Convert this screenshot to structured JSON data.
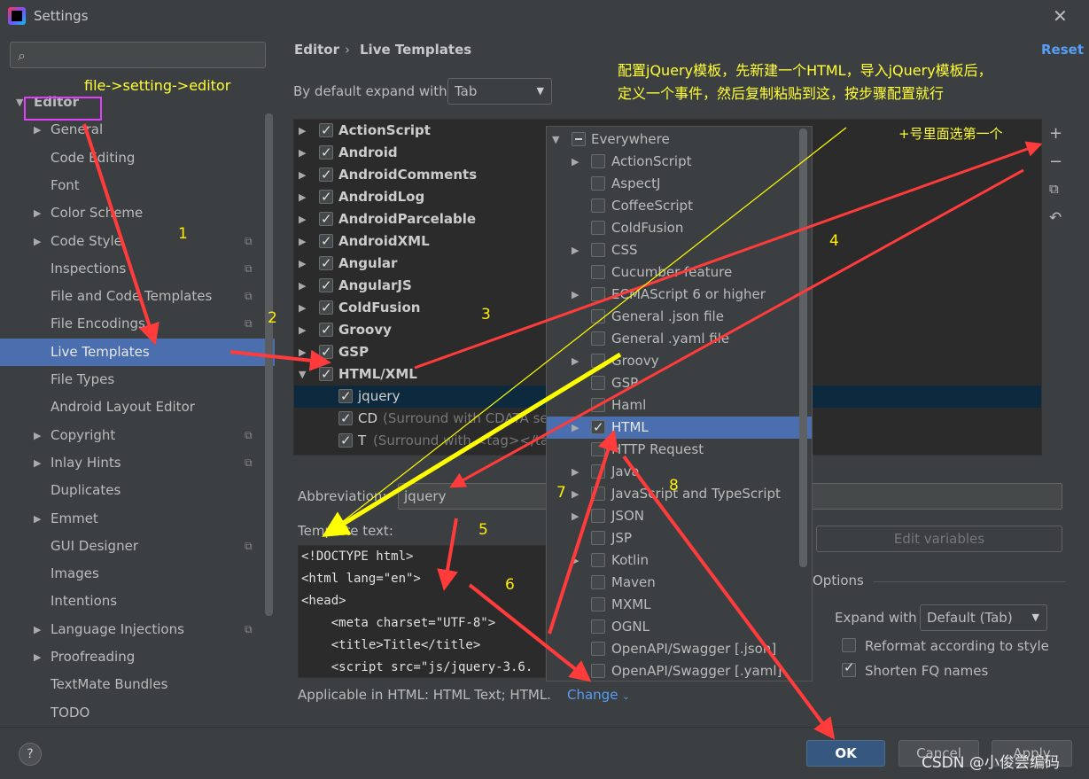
{
  "window": {
    "title": "Settings"
  },
  "search": {
    "placeholder": ""
  },
  "sidebar": {
    "items": [
      {
        "label": "Editor",
        "bold": true
      },
      {
        "label": "General",
        "arrow": true
      },
      {
        "label": "Code Editing"
      },
      {
        "label": "Font"
      },
      {
        "label": "Color Scheme",
        "arrow": true
      },
      {
        "label": "Code Style",
        "arrow": true,
        "copy": true
      },
      {
        "label": "Inspections",
        "copy": true
      },
      {
        "label": "File and Code Templates",
        "copy": true
      },
      {
        "label": "File Encodings",
        "copy": true
      },
      {
        "label": "Live Templates",
        "selected": true
      },
      {
        "label": "File Types"
      },
      {
        "label": "Android Layout Editor"
      },
      {
        "label": "Copyright",
        "arrow": true,
        "copy": true
      },
      {
        "label": "Inlay Hints",
        "arrow": true,
        "copy": true
      },
      {
        "label": "Duplicates"
      },
      {
        "label": "Emmet",
        "arrow": true
      },
      {
        "label": "GUI Designer",
        "copy": true
      },
      {
        "label": "Images"
      },
      {
        "label": "Intentions"
      },
      {
        "label": "Language Injections",
        "arrow": true,
        "copy": true
      },
      {
        "label": "Proofreading",
        "arrow": true
      },
      {
        "label": "TextMate Bundles"
      },
      {
        "label": "TODO"
      }
    ]
  },
  "header": {
    "breadcrumb_root": "Editor",
    "breadcrumb_sep": "›",
    "breadcrumb_leaf": "Live Templates",
    "reset": "Reset"
  },
  "expand": {
    "label": "By default expand with",
    "value": "Tab"
  },
  "templates": {
    "groups": [
      "ActionScript",
      "Android",
      "AndroidComments",
      "AndroidLog",
      "AndroidParcelable",
      "AndroidXML",
      "Angular",
      "AngularJS",
      "ColdFusion",
      "Groovy",
      "GSP",
      "HTML/XML"
    ],
    "children": [
      {
        "label": "jquery"
      },
      {
        "label": "CD",
        "desc": "(Surround with CDATA se"
      },
      {
        "label": "T",
        "desc": "(Surround with <tag></tag"
      }
    ]
  },
  "popup": {
    "root": "Everywhere",
    "items": [
      "ActionScript",
      "AspectJ",
      "CoffeeScript",
      "ColdFusion",
      "CSS",
      "Cucumber feature",
      "ECMAScript 6 or higher",
      "General .json file",
      "General .yaml file",
      "Groovy",
      "GSP",
      "Haml",
      "HTML",
      "HTTP Request",
      "Java",
      "JavaScript and TypeScript",
      "JSON",
      "JSP",
      "Kotlin",
      "Maven",
      "MXML",
      "OGNL",
      "OpenAPI/Swagger [.json]",
      "OpenAPI/Swagger [.yaml]"
    ],
    "selected": "HTML"
  },
  "form": {
    "abbr_label": "Abbreviation:",
    "abbr_value": "jquery",
    "tpl_label": "Template text:",
    "code": [
      "<!DOCTYPE html>",
      "<html lang=\"en\">",
      "<head>",
      "    <meta charset=\"UTF-8\">",
      "    <title>Title</title>",
      "    <script src=\"js/jquery-3.6."
    ],
    "edit_variables": "Edit variables",
    "options_title": "Options",
    "expand_with_label": "Expand with",
    "expand_with_value": "Default (Tab)",
    "reformat": "Reformat according to style",
    "shorten": "Shorten FQ names",
    "applicable": "Applicable in HTML: HTML Text; HTML.",
    "change": "Change"
  },
  "footer": {
    "help": "?",
    "ok": "OK",
    "cancel": "Cancel",
    "apply": "Apply"
  },
  "annotations": {
    "path": "file->setting->editor",
    "note_line1": "配置jQuery模板，先新建一个HTML，导入jQuery模板后，",
    "note_line2": "定义一个事件，然后复制粘贴到这，按步骤配置就行",
    "plus_note": "+号里面选第一个",
    "steps": [
      "1",
      "2",
      "3",
      "4",
      "5",
      "6",
      "7",
      "8"
    ]
  },
  "watermark": "CSDN @小俊尝编码",
  "colors": {
    "selection": "#4b6eaf",
    "accent_link": "#589df6",
    "arrow_red": "#ff3b3b",
    "arrow_yellow": "#ffff00",
    "annotation_yellow": "#ffff33",
    "highlight_box": "#e040fb"
  }
}
